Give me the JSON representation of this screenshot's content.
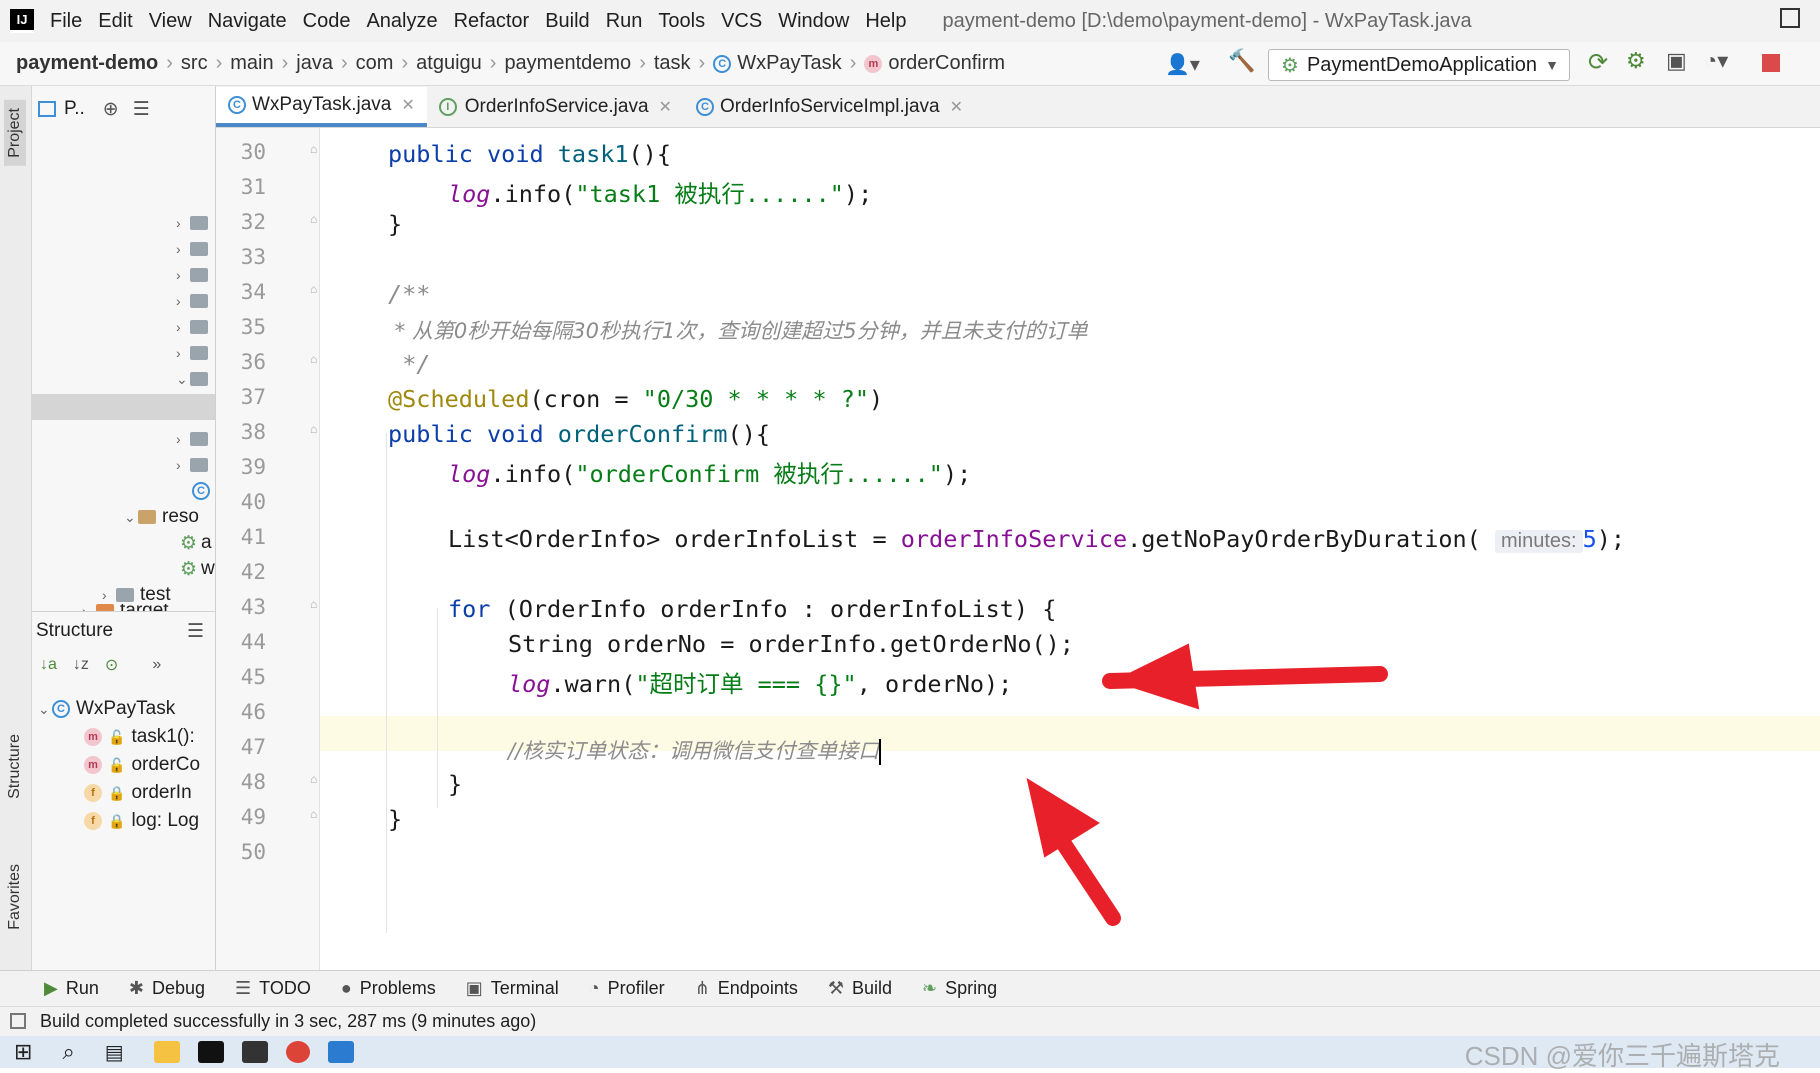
{
  "app": {
    "logo_text": "IJ",
    "window_title": "payment-demo [D:\\demo\\payment-demo] - WxPayTask.java",
    "menu": [
      "File",
      "Edit",
      "View",
      "Navigate",
      "Code",
      "Analyze",
      "Refactor",
      "Build",
      "Run",
      "Tools",
      "VCS",
      "Window",
      "Help"
    ]
  },
  "breadcrumb": {
    "items": [
      "payment-demo",
      "src",
      "main",
      "java",
      "com",
      "atguigu",
      "paymentdemo",
      "task",
      "WxPayTask",
      "orderConfirm"
    ]
  },
  "run_config": {
    "label": "PaymentDemoApplication"
  },
  "left_strip": {
    "project": "Project",
    "structure": "Structure",
    "favorites": "Favorites"
  },
  "project_panel": {
    "title": "P..",
    "rows": [
      "reso",
      "a",
      "w",
      "test",
      "target"
    ]
  },
  "structure_panel": {
    "title": "Structure",
    "root": "WxPayTask",
    "members": [
      "task1():",
      "orderCo",
      "orderIn",
      "log: Log"
    ]
  },
  "tabs": [
    {
      "label": "WxPayTask.java",
      "active": true
    },
    {
      "label": "OrderInfoService.java",
      "active": false
    },
    {
      "label": "OrderInfoServiceImpl.java",
      "active": false
    }
  ],
  "editor": {
    "line_numbers": [
      "30",
      "31",
      "32",
      "33",
      "34",
      "35",
      "36",
      "37",
      "38",
      "39",
      "40",
      "41",
      "42",
      "43",
      "44",
      "45",
      "46",
      "47",
      "48",
      "49",
      "50"
    ],
    "l30_kw": "public void ",
    "l30_fn": "task1",
    "l30_rest": "(){",
    "l31_log": "log",
    "l31_mid": ".info(",
    "l31_str": "\"task1 被执行......\"",
    "l31_end": ");",
    "l32": "}",
    "l34": "/**",
    "l35": " * 从第0秒开始每隔30秒执行1次，查询创建超过5分钟，并且未支付的订单",
    "l36": " */",
    "l37_ann": "@Scheduled",
    "l37_mid": "(cron = ",
    "l37_str": "\"0/30 * * * * ?\"",
    "l37_end": ")",
    "l38_kw": "public void ",
    "l38_fn": "orderConfirm",
    "l38_rest": "(){",
    "l39_log": "log",
    "l39_mid": ".info(",
    "l39_str": "\"orderConfirm 被执行......\"",
    "l39_end": ");",
    "l41_a": "List<OrderInfo> orderInfoList = ",
    "l41_field": "orderInfoService",
    "l41_b": ".getNoPayOrderByDuration(",
    "l41_hint": "minutes:",
    "l41_num": "5",
    "l41_end": ");",
    "l43_kw": "for",
    "l43_rest": " (OrderInfo orderInfo : orderInfoList) {",
    "l44": "String orderNo = orderInfo.getOrderNo();",
    "l45_log": "log",
    "l45_mid": ".warn(",
    "l45_str": "\"超时订单 === {}\"",
    "l45_end": ", orderNo);",
    "l47": "//核实订单状态：调用微信支付查单接口",
    "l48": "}",
    "l49": "}"
  },
  "bottom_tools": [
    "Run",
    "Debug",
    "TODO",
    "Problems",
    "Terminal",
    "Profiler",
    "Endpoints",
    "Build",
    "Spring"
  ],
  "status": {
    "text": "Build completed successfully in 3 sec, 287 ms (9 minutes ago)"
  },
  "watermark": "CSDN @爱你三千遍斯塔克",
  "colors": {
    "accent": "#4a88c7",
    "arrow": "#e8202a"
  }
}
